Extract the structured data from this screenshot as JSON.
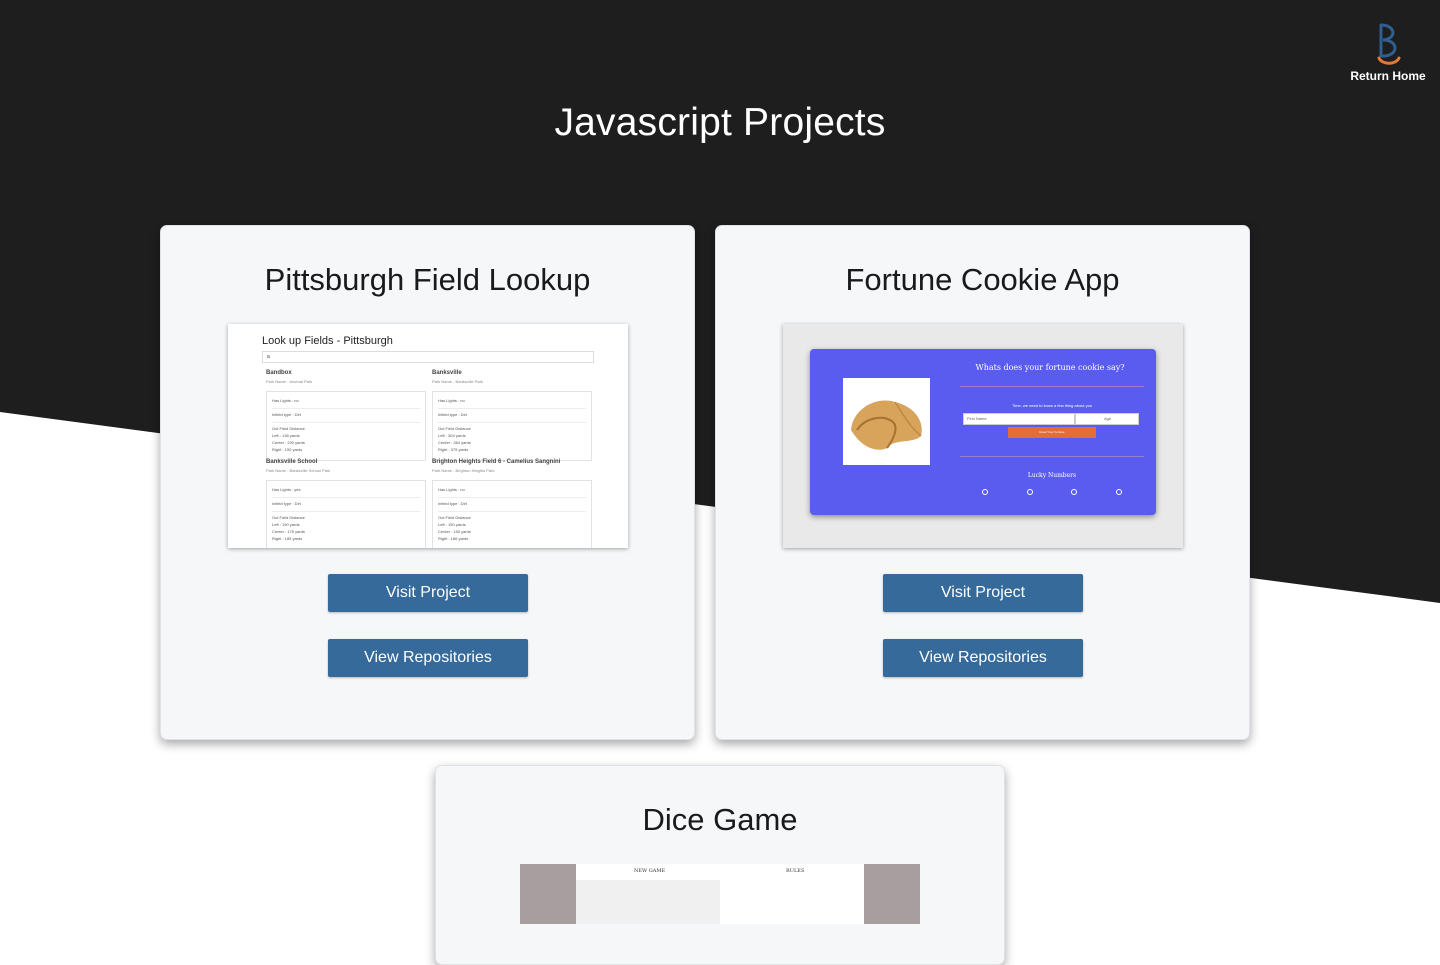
{
  "page": {
    "title": "Javascript Projects",
    "home_label": "Return Home",
    "colors": {
      "dark_bg": "#1e1e1e",
      "button": "#356a9a",
      "card": "#f5f7f9",
      "logo_blue": "#2f5f8f",
      "logo_orange": "#e07a3a"
    }
  },
  "projects": [
    {
      "title": "Pittsburgh Field Lookup",
      "visit_label": "Visit Project",
      "repo_label": "View Repositories",
      "thumbnail": {
        "heading": "Look up Fields - Pittsburgh",
        "search_value": "a",
        "fields": [
          {
            "name": "Bandbox",
            "park": "Park Name - Arsenal Park",
            "lights": "Has Lights : no",
            "infield": "Infield type : Dirt",
            "distance": "Out Field Distance",
            "left": "Left : 138 yards",
            "center": "Center : 200 yards",
            "right": "Right : 150 yards"
          },
          {
            "name": "Banksville",
            "park": "Park Name - Banksville Park",
            "lights": "Has Lights : no",
            "infield": "Infield type : Dirt",
            "distance": "Out Field Distance",
            "left": "Left : 304 yards",
            "center": "Center : 364 yards",
            "right": "Right : 375 yards"
          },
          {
            "name": "Banksville School",
            "park": "Park Name - Banksville School Park",
            "lights": "Has Lights : yes",
            "infield": "Infield type : Dirt",
            "distance": "Out Field Distance",
            "left": "Left : 190 yards",
            "center": "Center : 175 yards",
            "right": "Right : 185 yards"
          },
          {
            "name": "Brighton Heights Field 6 - Camelius Sangnini",
            "park": "Park Name - Brighton Heights Park",
            "lights": "Has Lights : no",
            "infield": "Infield type : Dirt",
            "distance": "Out Field Distance",
            "left": "Left : 150 yards",
            "center": "Center : 150 yards",
            "right": "Right : 186 yards"
          }
        ]
      }
    },
    {
      "title": "Fortune Cookie App",
      "visit_label": "Visit Project",
      "repo_label": "View Repositories",
      "thumbnail": {
        "question": "Whats does your fortune cookie say?",
        "hint": "Time, we need to know a few thing about you",
        "name_placeholder": "First Name",
        "age_placeholder": "Age",
        "button": "Read Your Fortune",
        "lucky": "Lucky Numbers",
        "numbers": [
          "0",
          "0",
          "0",
          "0"
        ]
      }
    },
    {
      "title": "Dice Game",
      "thumbnail": {
        "nav_left": "NEW GAME",
        "nav_right": "RULES"
      }
    }
  ]
}
